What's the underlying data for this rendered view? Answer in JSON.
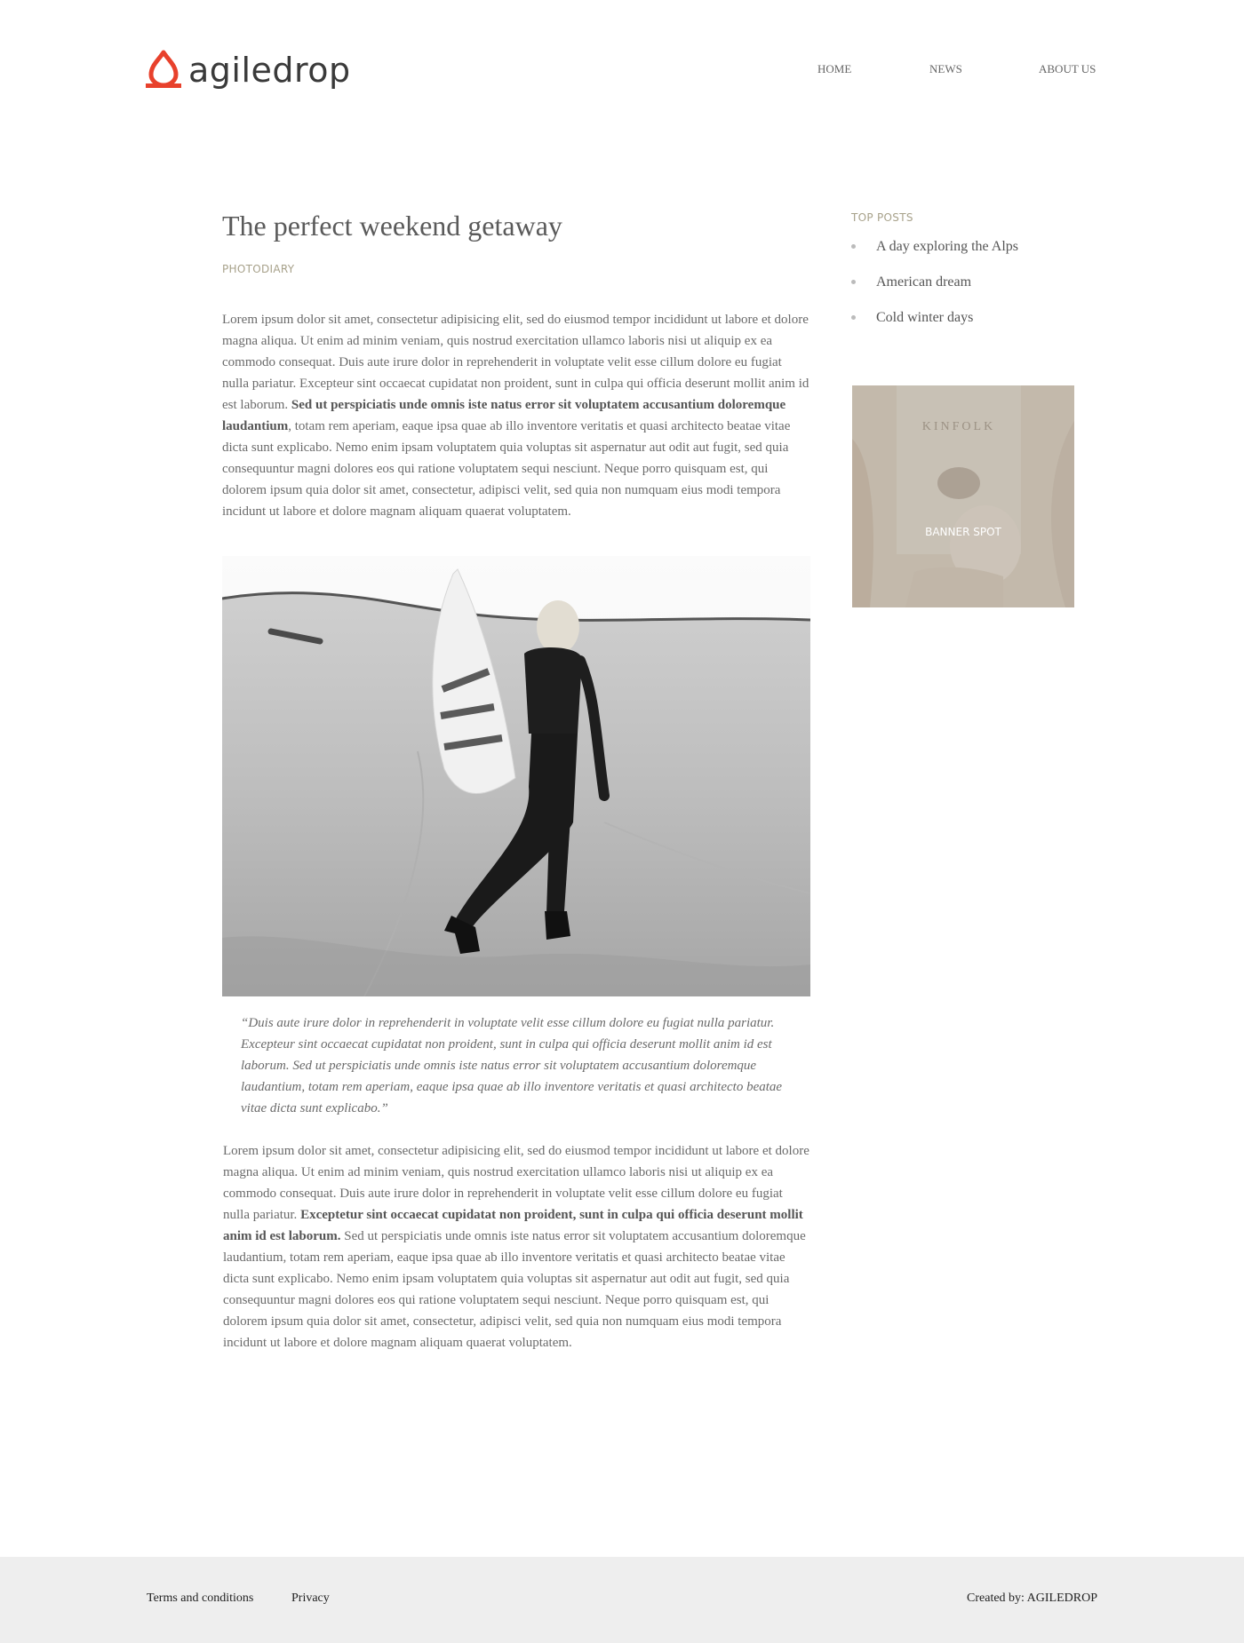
{
  "header": {
    "logo_text": "agiledrop",
    "brand_color": "#e8412c",
    "nav": [
      "HOME",
      "NEWS",
      "ABOUT US"
    ]
  },
  "article": {
    "title": "The perfect weekend getaway",
    "category": "PHOTODIARY",
    "para1": {
      "before": "Lorem ipsum dolor sit amet, consectetur adipisicing elit, sed do eiusmod tempor incididunt ut labore et dolore magna aliqua. Ut enim ad minim veniam, quis nostrud exercitation ullamco laboris nisi ut aliquip ex ea commodo consequat. Duis aute irure dolor in reprehenderit in voluptate velit esse cillum dolore eu fugiat nulla pariatur. Excepteur sint occaecat cupidatat non proident, sunt in culpa qui officia deserunt mollit anim id est laborum. ",
      "bold": "Sed ut perspiciatis unde omnis iste natus error sit voluptatem accusantium doloremque laudantium",
      "after": ", totam rem aperiam, eaque ipsa quae ab illo inventore veritatis et quasi architecto beatae vitae dicta sunt explicabo. Nemo enim ipsam voluptatem quia voluptas sit aspernatur aut odit aut fugit, sed quia consequuntur magni dolores eos qui ratione voluptatem sequi nesciunt. Neque porro quisquam est, qui dolorem ipsum quia dolor sit amet, consectetur, adipisci velit, sed quia non numquam eius modi tempora incidunt ut labore et dolore magnam aliquam quaerat voluptatem."
    },
    "quote": "“Duis aute irure dolor in reprehenderit in voluptate velit esse cillum dolore eu fugiat nulla pariatur. Excepteur sint occaecat cupidatat non proident, sunt in culpa qui officia deserunt mollit anim id est laborum. Sed ut perspiciatis unde omnis iste natus error sit voluptatem accusantium doloremque laudantium, totam rem aperiam, eaque ipsa quae ab illo inventore veritatis et quasi architecto beatae vitae dicta sunt explicabo.”",
    "para2": {
      "before": "Lorem ipsum dolor sit amet, consectetur adipisicing elit, sed do eiusmod tempor incididunt ut labore et dolore magna aliqua. Ut enim ad minim veniam, quis nostrud exercitation ullamco laboris nisi ut aliquip ex ea commodo consequat. Duis aute irure dolor in reprehenderit in voluptate velit esse cillum dolore eu fugiat nulla pariatur. ",
      "bold": "Exceptetur sint occaecat cupidatat non proident, sunt in culpa qui officia deserunt mollit anim id est laborum.",
      "after": " Sed ut perspiciatis unde omnis iste natus error sit voluptatem accusantium doloremque laudantium, totam rem aperiam, eaque ipsa quae ab illo inventore veritatis et quasi architecto beatae vitae dicta sunt explicabo. Nemo enim ipsam voluptatem quia voluptas sit aspernatur aut odit aut fugit, sed quia consequuntur magni dolores eos qui ratione voluptatem sequi nesciunt. Neque porro quisquam est, qui dolorem ipsum quia dolor sit amet, consectetur, adipisci velit, sed quia non numquam eius modi tempora incidunt ut labore et dolore magnam aliquam quaerat voluptatem."
    }
  },
  "sidebar": {
    "title": "TOP POSTS",
    "posts": [
      "A day exploring the Alps",
      "American dream",
      "Cold winter days"
    ],
    "banner_label": "BANNER SPOT",
    "banner_magazine_text": "KINFOLK"
  },
  "footer": {
    "terms": "Terms and conditions",
    "privacy": "Privacy",
    "credit": "Created by: AGILEDROP"
  }
}
